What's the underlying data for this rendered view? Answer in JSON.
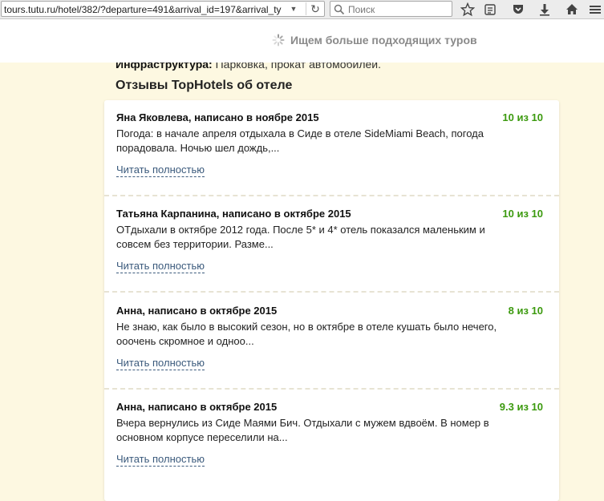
{
  "browser": {
    "url": "tours.tutu.ru/hotel/382/?departure=491&arrival_id=197&arrival_ty",
    "search_placeholder": "Поиск"
  },
  "notice": {
    "text": "Ищем больше подходящих туров"
  },
  "page": {
    "partial_label": "Инфраструктура:",
    "partial_value": " Парковка, прокат автомобилей.",
    "section_title": "Отзывы TopHotels об отеле"
  },
  "reviews": [
    {
      "author": "Яна Яковлева, написано в ноябре 2015",
      "score": "10 из 10",
      "text": "Погода: в начале апреля отдыхала в Сиде в отеле SideMiami Beach, погода порадовала. Ночью шел дождь,...",
      "link": "Читать полностью"
    },
    {
      "author": "Татьяна Карпанина, написано в октябре 2015",
      "score": "10 из 10",
      "text": "ОТдыхали в октябре 2012 года. После 5* и 4* отель показался маленьким и совсем без территории. Разме...",
      "link": "Читать полностью"
    },
    {
      "author": "Анна, написано в октябре 2015",
      "score": "8 из 10",
      "text": "Не знаю, как было в высокий сезон, но в октябре в отеле кушать было нечего, ооочень скромное и одноо...",
      "link": "Читать полностью"
    },
    {
      "author": "Анна, написано в октябре 2015",
      "score": "9.3 из 10",
      "text": "Вчера вернулись из Сиде Маями Бич. Отдыхали с мужем вдвоём. В номер в основном корпусе переселили на...",
      "link": "Читать полностью"
    }
  ],
  "colors": {
    "score_green": "#3c9a0f",
    "link_blue": "#3b5a7c",
    "page_background": "#fdf8e1"
  }
}
